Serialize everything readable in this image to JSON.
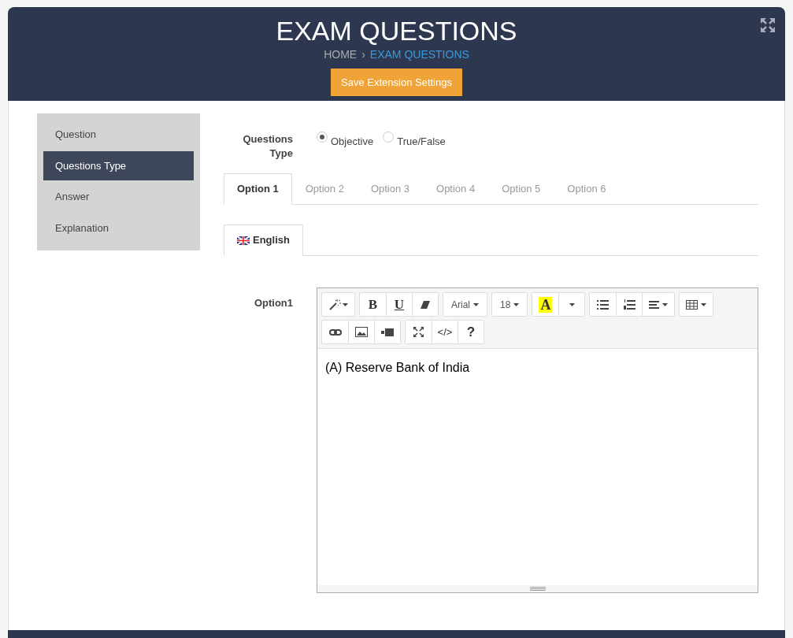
{
  "header": {
    "title": "EXAM QUESTIONS",
    "breadcrumb": [
      {
        "label": "HOME",
        "selected": false
      },
      {
        "label": "EXAM QUESTIONS",
        "selected": true
      }
    ],
    "separator": "›",
    "save_button": "Save Extension Settings"
  },
  "sidebar": {
    "items": [
      {
        "label": "Question",
        "selected": false
      },
      {
        "label": "Questions Type",
        "selected": true
      },
      {
        "label": "Answer",
        "selected": false
      },
      {
        "label": "Explanation",
        "selected": false
      }
    ]
  },
  "questions_type": {
    "label": "Questions Type",
    "options": [
      {
        "label": "Objective",
        "selected": true
      },
      {
        "label": "True/False",
        "selected": false
      }
    ]
  },
  "option_tabs": [
    {
      "label": "Option 1",
      "selected": true
    },
    {
      "label": "Option 2",
      "selected": false
    },
    {
      "label": "Option 3",
      "selected": false
    },
    {
      "label": "Option 4",
      "selected": false
    },
    {
      "label": "Option 5",
      "selected": false
    },
    {
      "label": "Option 6",
      "selected": false
    }
  ],
  "language_tabs": [
    {
      "label": "English",
      "selected": true
    }
  ],
  "editor": {
    "label": "Option1",
    "toolbar": [
      [
        [
          {
            "kind": "magic"
          }
        ],
        [
          {
            "kind": "bold",
            "label": "B"
          },
          {
            "kind": "underline",
            "label": "U"
          },
          {
            "kind": "eraser"
          }
        ],
        [
          {
            "kind": "dropdown",
            "label": "Arial"
          }
        ],
        [
          {
            "kind": "dropdown",
            "label": "18"
          }
        ],
        [
          {
            "kind": "color",
            "label": "A"
          },
          {
            "kind": "caret"
          }
        ],
        [
          {
            "kind": "bullets"
          },
          {
            "kind": "numbers"
          },
          {
            "kind": "align"
          }
        ],
        [
          {
            "kind": "table"
          }
        ]
      ],
      [
        [
          {
            "kind": "link"
          },
          {
            "kind": "image"
          },
          {
            "kind": "video"
          }
        ],
        [
          {
            "kind": "fullscreen"
          },
          {
            "kind": "text",
            "label": "</>"
          },
          {
            "kind": "help",
            "label": "?"
          }
        ]
      ]
    ],
    "content": "(A) Reserve Bank of India"
  }
}
